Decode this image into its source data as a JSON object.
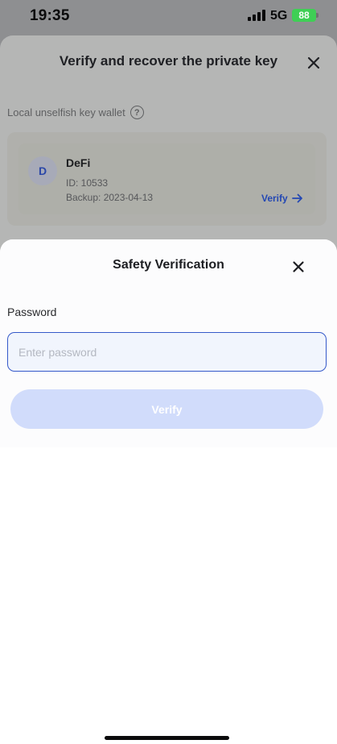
{
  "status_bar": {
    "time": "19:35",
    "network": "5G",
    "battery": "88"
  },
  "background_sheet": {
    "title": "Verify and recover the private key",
    "section_label": "Local unselfish key wallet",
    "help_icon_glyph": "?",
    "wallet": {
      "avatar_letter": "D",
      "name": "DeFi",
      "id": "ID: 10533",
      "backup": "Backup: 2023-04-13",
      "verify_label": "Verify"
    }
  },
  "dialog": {
    "title": "Safety Verification",
    "password_label": "Password",
    "password_placeholder": "Enter password",
    "password_value": "",
    "verify_button": "Verify"
  },
  "icons": {
    "close": "close-icon",
    "help": "question-circle-icon",
    "arrow": "arrow-right-icon",
    "signal": "cellular-signal-icon",
    "battery": "battery-icon"
  },
  "colors": {
    "accent": "#3559c9",
    "button_disabled": "#d1dcfb",
    "battery_green": "#3fcf55"
  }
}
